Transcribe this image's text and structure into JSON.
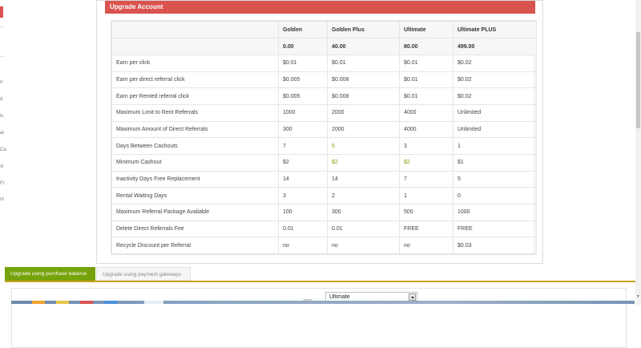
{
  "panel": {
    "title": "Upgrade Account"
  },
  "table": {
    "columns": [
      "",
      "Golden",
      "Golden Plus",
      "Ultimate",
      "Ultimate PLUS"
    ],
    "prices": [
      "",
      "0.00",
      "40.00",
      "80.00",
      "499.00"
    ],
    "rows": [
      [
        "Earn per click",
        "$0.01",
        "$0.01",
        "$0.01",
        "$0.02"
      ],
      [
        "Earn per direct referral click",
        "$0.005",
        "$0.008",
        "$0.01",
        "$0.02"
      ],
      [
        "Earn per Rented referral click",
        "$0.005",
        "$0.008",
        "$0.01",
        "$0.02"
      ],
      [
        "Maximum Limit to Rent Referrals",
        "1000",
        "2000",
        "4000",
        "Unlimited"
      ],
      [
        "Maximum Amount of Direct Referrals",
        "300",
        "2000",
        "4000",
        "Unlimited"
      ],
      [
        "Days Between Cashouts",
        "7",
        "5",
        "3",
        "1"
      ],
      [
        "Minimum Cashout",
        "$2",
        "$2",
        "$2",
        "$1"
      ],
      [
        "Inactivity Days Free Replacement",
        "14",
        "14",
        "7",
        "5"
      ],
      [
        "Rental Waiting Days",
        "3",
        "2",
        "1",
        "0"
      ],
      [
        "Maximum Referral Package Available",
        "100",
        "300",
        "500",
        "1000"
      ],
      [
        "Delete Direct Referrals Fee",
        "0.01",
        "0.01",
        "FREE",
        "FREE"
      ],
      [
        "Recycle Discount per Referral",
        "no",
        "no",
        "no",
        "$0.03"
      ]
    ],
    "highlight_color": "#7aa000"
  },
  "tabs": {
    "purchase_balance": "Upgrade using purchase balance",
    "payment_gateways": "Upgrade using payment gateways"
  },
  "form": {
    "item_label": "Item",
    "item_value": "Ultimate"
  },
  "colors": {
    "header_red": "#d9534f",
    "tab_green": "#77a20b",
    "accent_gold": "#c9a21b"
  }
}
